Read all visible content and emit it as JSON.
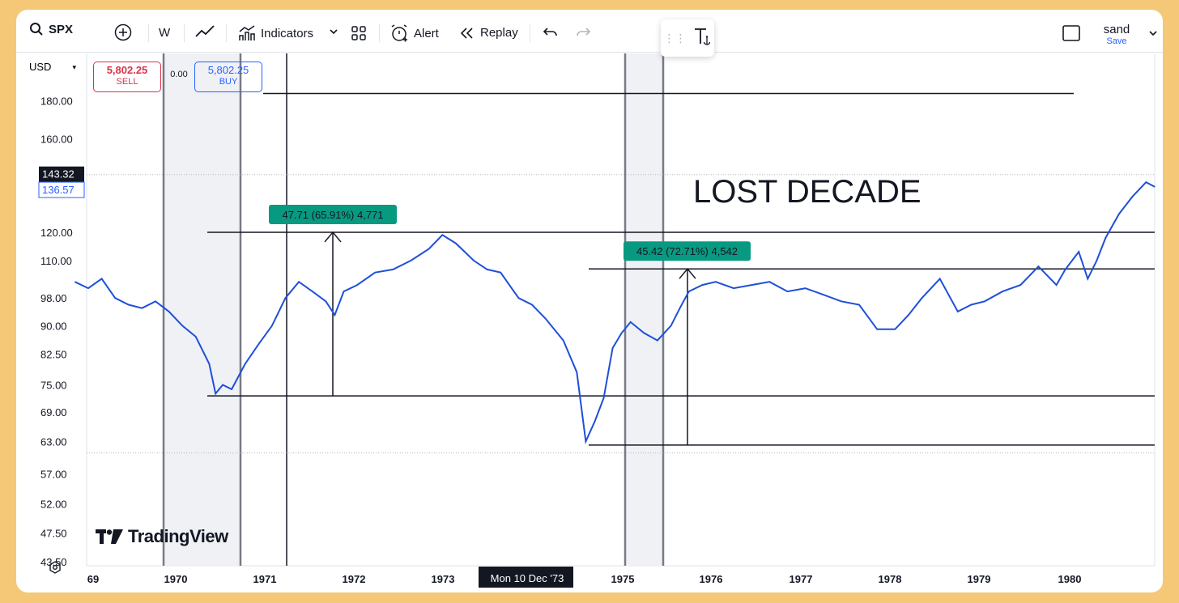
{
  "toolbar": {
    "symbol": "SPX",
    "interval": "W",
    "indicators_label": "Indicators",
    "alert_label": "Alert",
    "replay_label": "Replay",
    "layout_name": "sand",
    "save_label": "Save"
  },
  "price_panel": {
    "currency": "USD",
    "sell_price": "5,802.25",
    "sell_label": "SELL",
    "spread": "0.00",
    "buy_price": "5,802.25",
    "buy_label": "BUY"
  },
  "colors": {
    "series": "#1e4fd8",
    "measure": "#089981",
    "sell": "#d8324a",
    "buy": "#2962ff"
  },
  "chart_data": {
    "type": "line",
    "symbol": "SPX",
    "title": "",
    "annotation": "LOST DECADE",
    "x_tick_labels": [
      "69",
      "1970",
      "1971",
      "1972",
      "1973",
      "Mon 10 Dec '73",
      "1975",
      "1976",
      "1977",
      "1978",
      "1979",
      "1980"
    ],
    "y_tick_labels": [
      "180.00",
      "160.00",
      "143.32",
      "136.57",
      "120.00",
      "110.00",
      "98.00",
      "90.00",
      "82.50",
      "75.00",
      "69.00",
      "63.00",
      "57.00",
      "52.00",
      "47.50",
      "43.50"
    ],
    "price_labels": {
      "last": "143.32",
      "previous": "136.57"
    },
    "measurements": [
      {
        "label": "47.71 (65.91%) 4,771",
        "from": 72.5,
        "to": 120.0
      },
      {
        "label": "45.42 (72.71%) 4,542",
        "from": 62.3,
        "to": 107.2
      }
    ],
    "horizontal_lines": [
      184,
      120,
      107.2,
      72.5,
      62.3
    ],
    "series": [
      {
        "x": [
          1968.85,
          1969.0,
          1969.15,
          1969.3,
          1969.45,
          1969.6,
          1969.75,
          1969.9,
          1970.05,
          1970.2,
          1970.35,
          1970.42,
          1970.5,
          1970.6,
          1970.75,
          1970.9,
          1971.05,
          1971.2,
          1971.35,
          1971.5,
          1971.65,
          1971.75,
          1971.85,
          1972.0,
          1972.2,
          1972.4,
          1972.6,
          1972.8,
          1972.95,
          1973.1,
          1973.3,
          1973.45,
          1973.6,
          1973.8,
          1973.95,
          1974.1,
          1974.3,
          1974.45,
          1974.55,
          1974.65,
          1974.75,
          1974.85,
          1974.95,
          1975.05,
          1975.2,
          1975.35,
          1975.5,
          1975.6,
          1975.7,
          1975.85,
          1976.0,
          1976.2,
          1976.4,
          1976.6,
          1976.8,
          1977.0,
          1977.2,
          1977.4,
          1977.6,
          1977.8,
          1978.0,
          1978.15,
          1978.3,
          1978.5,
          1978.7,
          1978.85,
          1979.0,
          1979.2,
          1979.4,
          1979.6,
          1979.8,
          1979.9,
          1980.05,
          1980.15,
          1980.25,
          1980.35,
          1980.5,
          1980.65,
          1980.8,
          1980.9
        ],
        "values": [
          103,
          101,
          104,
          98,
          96,
          95,
          97,
          94,
          90,
          87,
          80,
          73,
          75,
          74,
          80,
          85,
          90,
          98,
          103,
          100,
          97,
          93,
          100,
          102,
          106,
          107,
          110,
          114,
          119,
          116,
          110,
          107,
          106,
          98,
          96,
          92,
          86,
          78,
          63,
          67,
          72,
          84,
          88,
          91,
          88,
          86,
          90,
          95,
          100,
          102,
          103,
          101,
          102,
          103,
          100,
          101,
          99,
          97,
          96,
          89,
          89,
          93,
          98,
          104,
          94,
          96,
          97,
          100,
          102,
          108,
          102,
          107,
          113,
          104,
          110,
          118,
          127,
          134,
          140,
          138
        ]
      }
    ]
  }
}
